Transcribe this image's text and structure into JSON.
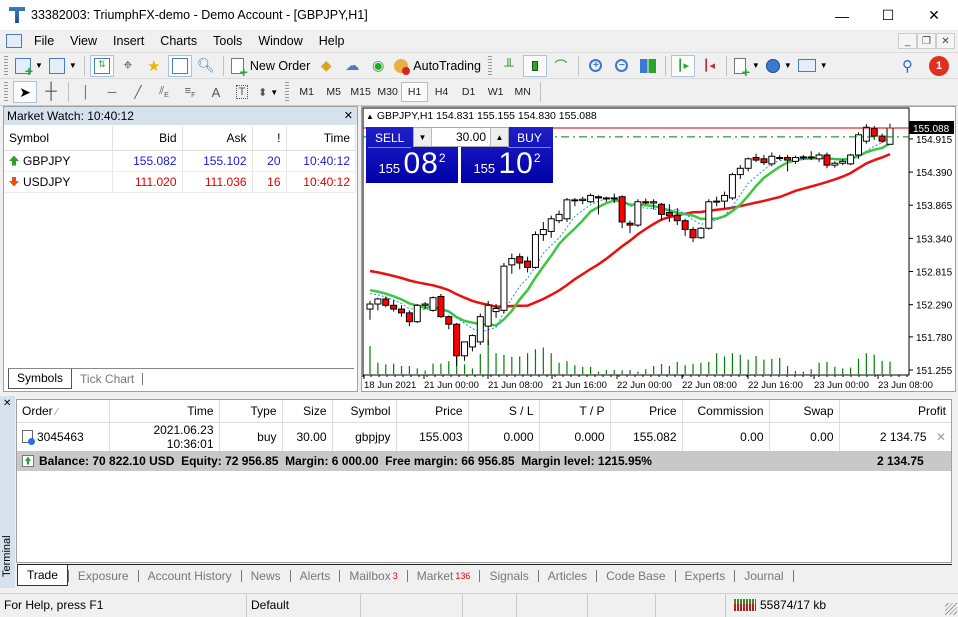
{
  "window": {
    "title": "33382003: TriumphFX-demo - Demo Account - [GBPJPY,H1]",
    "controls": {
      "minimize": "—",
      "maximize": "☐",
      "close": "✕"
    }
  },
  "menu": {
    "items": [
      {
        "label": "File",
        "accel": "F"
      },
      {
        "label": "View",
        "accel": "V"
      },
      {
        "label": "Insert",
        "accel": "I"
      },
      {
        "label": "Charts",
        "accel": "C"
      },
      {
        "label": "Tools",
        "accel": "T"
      },
      {
        "label": "Window",
        "accel": "W"
      },
      {
        "label": "Help",
        "accel": "H"
      }
    ],
    "mdi_controls": {
      "minimize": "_",
      "restore": "❐",
      "close": "✕"
    }
  },
  "toolbar": {
    "new_order_label": "New Order",
    "autotrading_label": "AutoTrading",
    "notification_count": "1",
    "timeframes": [
      "M1",
      "M5",
      "M15",
      "M30",
      "H1",
      "H4",
      "D1",
      "W1",
      "MN"
    ],
    "active_timeframe": "H1"
  },
  "market_watch": {
    "title": "Market Watch: 10:40:12",
    "columns": [
      "Symbol",
      "Bid",
      "Ask",
      "!",
      "Time"
    ],
    "rows": [
      {
        "symbol": "GBPJPY",
        "bid": "155.082",
        "ask": "155.102",
        "spread": "20",
        "time": "10:40:12",
        "direction": "up"
      },
      {
        "symbol": "USDJPY",
        "bid": "111.020",
        "ask": "111.036",
        "spread": "16",
        "time": "10:40:12",
        "direction": "down"
      }
    ],
    "tabs": [
      "Symbols",
      "Tick Chart"
    ],
    "active_tab": "Symbols"
  },
  "chart": {
    "header": "GBPJPY,H1  154.831 155.155 154.830 155.088",
    "one_click": {
      "sell_label": "SELL",
      "buy_label": "BUY",
      "lot": "30.00",
      "sell_price": {
        "prefix": "155",
        "big": "08",
        "sup": "2"
      },
      "buy_price": {
        "prefix": "155",
        "big": "10",
        "sup": "2"
      }
    },
    "current_price_label": "155.088",
    "colors": {
      "bull_body": "#ffffff",
      "bear_body": "#ff0000",
      "ma_fast": "#3cc83c",
      "ma_slow": "#e81010",
      "ma_dotted": "#1e90ff",
      "volume": "#008000",
      "bid_line": "#cc0000",
      "order_line": "#008000"
    }
  },
  "chart_data": {
    "type": "candlestick",
    "symbol": "GBPJPY",
    "timeframe": "H1",
    "ylim": [
      151.255,
      155.2
    ],
    "y_ticks": [
      "154.915",
      "154.390",
      "153.865",
      "153.340",
      "152.815",
      "152.290",
      "151.780",
      "151.255"
    ],
    "x_ticks": [
      "18 Jun 2021",
      "21 Jun 00:00",
      "21 Jun 08:00",
      "21 Jun 16:00",
      "22 Jun 00:00",
      "22 Jun 08:00",
      "22 Jun 16:00",
      "23 Jun 00:00",
      "23 Jun 08:00"
    ],
    "bid_price": 155.088,
    "order_price": 154.915,
    "candles": [
      [
        152.22,
        152.35,
        152.05,
        152.3
      ],
      [
        152.3,
        152.4,
        152.2,
        152.38
      ],
      [
        152.38,
        152.42,
        152.25,
        152.28
      ],
      [
        152.28,
        152.36,
        152.18,
        152.22
      ],
      [
        152.22,
        152.28,
        152.1,
        152.16
      ],
      [
        152.16,
        152.2,
        151.95,
        152.02
      ],
      [
        152.02,
        152.3,
        152.0,
        152.28
      ],
      [
        152.28,
        152.33,
        152.22,
        152.3
      ],
      [
        152.2,
        152.42,
        152.18,
        152.4
      ],
      [
        152.42,
        152.46,
        152.08,
        152.1
      ],
      [
        152.1,
        152.12,
        151.9,
        151.98
      ],
      [
        151.98,
        152.0,
        151.32,
        151.48
      ],
      [
        151.48,
        151.7,
        151.4,
        151.7
      ],
      [
        151.62,
        151.82,
        151.55,
        151.8
      ],
      [
        151.7,
        152.15,
        151.65,
        152.1
      ],
      [
        151.95,
        152.35,
        151.65,
        152.28
      ],
      [
        152.18,
        152.3,
        152.08,
        152.23
      ],
      [
        152.2,
        152.95,
        152.15,
        152.9
      ],
      [
        152.92,
        153.1,
        152.78,
        153.02
      ],
      [
        153.05,
        153.1,
        152.85,
        152.95
      ],
      [
        152.98,
        153.05,
        152.8,
        152.88
      ],
      [
        152.88,
        153.45,
        152.86,
        153.4
      ],
      [
        153.4,
        153.6,
        153.3,
        153.48
      ],
      [
        153.45,
        153.7,
        153.35,
        153.65
      ],
      [
        153.62,
        153.78,
        153.58,
        153.72
      ],
      [
        153.65,
        153.98,
        153.6,
        153.95
      ],
      [
        153.95,
        153.98,
        153.85,
        153.94
      ],
      [
        153.94,
        154.0,
        153.88,
        153.96
      ],
      [
        153.92,
        154.05,
        153.9,
        154.02
      ],
      [
        154.0,
        154.02,
        153.72,
        153.98
      ],
      [
        153.98,
        154.0,
        153.92,
        153.97
      ],
      [
        153.97,
        154.05,
        153.9,
        153.98
      ],
      [
        154.0,
        154.02,
        153.5,
        153.6
      ],
      [
        153.58,
        153.62,
        153.42,
        153.55
      ],
      [
        153.55,
        153.96,
        153.52,
        153.92
      ],
      [
        153.92,
        153.97,
        153.88,
        153.9
      ],
      [
        153.9,
        153.96,
        153.8,
        153.92
      ],
      [
        153.88,
        153.9,
        153.62,
        153.72
      ],
      [
        153.75,
        153.88,
        153.6,
        153.7
      ],
      [
        153.7,
        153.82,
        153.55,
        153.62
      ],
      [
        153.62,
        153.65,
        153.38,
        153.48
      ],
      [
        153.48,
        153.52,
        153.28,
        153.35
      ],
      [
        153.35,
        153.52,
        153.33,
        153.5
      ],
      [
        153.5,
        153.96,
        153.48,
        153.92
      ],
      [
        153.92,
        154.0,
        153.85,
        153.93
      ],
      [
        153.93,
        154.08,
        153.82,
        154.02
      ],
      [
        153.98,
        154.38,
        153.95,
        154.35
      ],
      [
        154.35,
        154.5,
        154.28,
        154.45
      ],
      [
        154.45,
        154.62,
        154.4,
        154.6
      ],
      [
        154.62,
        154.68,
        154.55,
        154.58
      ],
      [
        154.6,
        154.66,
        154.5,
        154.54
      ],
      [
        154.52,
        154.7,
        154.48,
        154.64
      ],
      [
        154.62,
        154.66,
        154.58,
        154.61
      ],
      [
        154.62,
        154.66,
        154.4,
        154.58
      ],
      [
        154.56,
        154.65,
        154.52,
        154.62
      ],
      [
        154.62,
        154.66,
        154.58,
        154.63
      ],
      [
        154.62,
        154.72,
        154.58,
        154.63
      ],
      [
        154.6,
        154.7,
        154.55,
        154.66
      ],
      [
        154.66,
        154.7,
        154.45,
        154.5
      ],
      [
        154.5,
        154.56,
        154.46,
        154.53
      ],
      [
        154.53,
        154.6,
        154.5,
        154.56
      ],
      [
        154.52,
        154.68,
        154.5,
        154.66
      ],
      [
        154.66,
        155.02,
        154.6,
        154.98
      ],
      [
        154.88,
        155.15,
        154.84,
        155.1
      ],
      [
        155.08,
        155.12,
        154.9,
        154.96
      ],
      [
        154.96,
        155.0,
        154.85,
        154.88
      ],
      [
        154.83,
        155.155,
        154.83,
        155.088
      ]
    ],
    "volumes": [
      0.7,
      0.28,
      0.24,
      0.26,
      0.2,
      0.2,
      0.14,
      0.09,
      0.26,
      0.26,
      0.32,
      0.55,
      0.24,
      0.14,
      0.5,
      0.86,
      0.52,
      0.48,
      0.43,
      0.44,
      0.52,
      0.62,
      0.66,
      0.52,
      0.28,
      0.32,
      0.22,
      0.18,
      0.18,
      0.06,
      0.1,
      0.1,
      0.09,
      0.1,
      0.06,
      0.12,
      0.2,
      0.25,
      0.2,
      0.3,
      0.22,
      0.25,
      0.28,
      0.3,
      0.52,
      0.44,
      0.52,
      0.48,
      0.36,
      0.45,
      0.36,
      0.38,
      0.4,
      0.2,
      0.08,
      0.06,
      0.12,
      0.28,
      0.3,
      0.18,
      0.14,
      0.16,
      0.38,
      0.52,
      0.48,
      0.33,
      0.31
    ],
    "ma_fast_label": "green MA",
    "ma_slow_label": "red MA"
  },
  "terminal": {
    "side_label": "Terminal",
    "columns": [
      "Order",
      "Time",
      "Type",
      "Size",
      "Symbol",
      "Price",
      "S / L",
      "T / P",
      "Price",
      "Commission",
      "Swap",
      "Profit"
    ],
    "orders": [
      {
        "order": "3045463",
        "time": "2021.06.23 10:36:01",
        "type": "buy",
        "size": "30.00",
        "symbol": "gbpjpy",
        "price": "155.003",
        "sl": "0.000",
        "tp": "0.000",
        "current_price": "155.082",
        "commission": "0.00",
        "swap": "0.00",
        "profit": "2 134.75"
      }
    ],
    "summary": "Balance: 70 822.10 USD  Equity: 72 956.85  Margin: 6 000.00  Free margin: 66 956.85  Margin level: 1215.95%",
    "summary_profit": "2 134.75",
    "tabs": [
      {
        "label": "Trade",
        "badge": ""
      },
      {
        "label": "Exposure",
        "badge": ""
      },
      {
        "label": "Account History",
        "badge": ""
      },
      {
        "label": "News",
        "badge": ""
      },
      {
        "label": "Alerts",
        "badge": ""
      },
      {
        "label": "Mailbox",
        "badge": "3"
      },
      {
        "label": "Market",
        "badge": "136"
      },
      {
        "label": "Signals",
        "badge": ""
      },
      {
        "label": "Articles",
        "badge": ""
      },
      {
        "label": "Code Base",
        "badge": ""
      },
      {
        "label": "Experts",
        "badge": ""
      },
      {
        "label": "Journal",
        "badge": ""
      }
    ],
    "active_tab": "Trade"
  },
  "status_bar": {
    "help": "For Help, press F1",
    "profile": "Default",
    "connection": "55874/17 kb"
  }
}
